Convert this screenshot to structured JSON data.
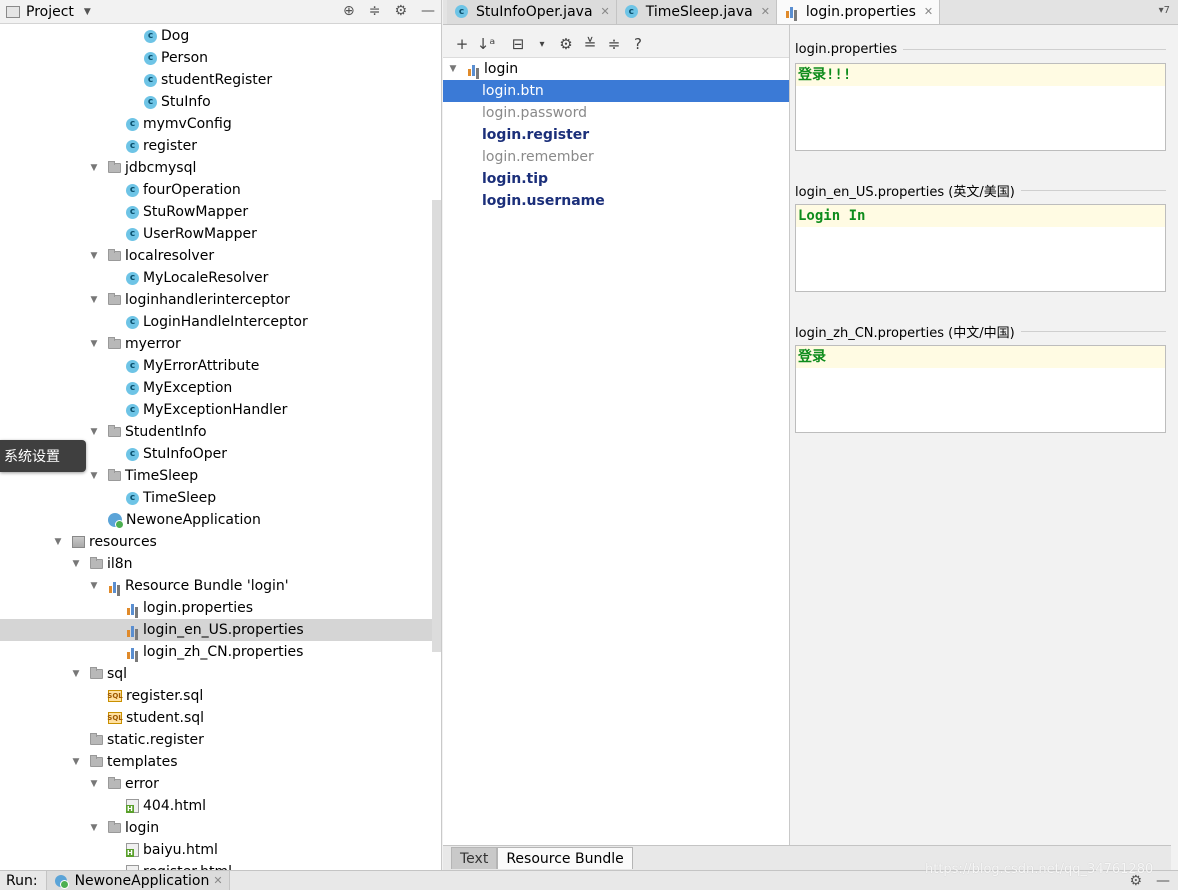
{
  "project_panel": {
    "title": "Project",
    "tools": [
      "target-icon",
      "collapse-icon",
      "gear-icon",
      "minimize-icon"
    ],
    "tree": [
      {
        "label": "Dog",
        "icon": "class-icon",
        "indent": 3,
        "caret": "none"
      },
      {
        "label": "Person",
        "icon": "class-icon",
        "indent": 3,
        "caret": "none"
      },
      {
        "label": "studentRegister",
        "icon": "class-icon",
        "indent": 3,
        "caret": "none"
      },
      {
        "label": "StuInfo",
        "icon": "class-icon",
        "indent": 3,
        "caret": "none"
      },
      {
        "label": "mymvConfig",
        "icon": "class-icon",
        "indent": 2,
        "caret": "none"
      },
      {
        "label": "register",
        "icon": "class-icon",
        "indent": 2,
        "caret": "none"
      },
      {
        "label": "jdbcmysql",
        "icon": "folder-icon",
        "indent": 1,
        "caret": "open"
      },
      {
        "label": "fourOperation",
        "icon": "class-icon",
        "indent": 2,
        "caret": "none"
      },
      {
        "label": "StuRowMapper",
        "icon": "class-icon",
        "indent": 2,
        "caret": "none"
      },
      {
        "label": "UserRowMapper",
        "icon": "class-icon",
        "indent": 2,
        "caret": "none"
      },
      {
        "label": "localresolver",
        "icon": "folder-icon",
        "indent": 1,
        "caret": "open"
      },
      {
        "label": "MyLocaleResolver",
        "icon": "class-icon",
        "indent": 2,
        "caret": "none"
      },
      {
        "label": "loginhandlerinterceptor",
        "icon": "folder-icon",
        "indent": 1,
        "caret": "open"
      },
      {
        "label": "LoginHandleInterceptor",
        "icon": "class-icon",
        "indent": 2,
        "caret": "none"
      },
      {
        "label": "myerror",
        "icon": "folder-icon",
        "indent": 1,
        "caret": "open"
      },
      {
        "label": "MyErrorAttribute",
        "icon": "class-icon",
        "indent": 2,
        "caret": "none"
      },
      {
        "label": "MyException",
        "icon": "class-icon",
        "indent": 2,
        "caret": "none"
      },
      {
        "label": "MyExceptionHandler",
        "icon": "class-icon",
        "indent": 2,
        "caret": "none"
      },
      {
        "label": "StudentInfo",
        "icon": "folder-icon",
        "indent": 1,
        "caret": "open"
      },
      {
        "label": "StuInfoOper",
        "icon": "class-icon",
        "indent": 2,
        "caret": "none"
      },
      {
        "label": "TimeSleep",
        "icon": "folder-icon",
        "indent": 1,
        "caret": "open"
      },
      {
        "label": "TimeSleep",
        "icon": "class-icon",
        "indent": 2,
        "caret": "none"
      },
      {
        "label": "NewoneApplication",
        "icon": "app-icon",
        "indent": 1,
        "caret": "none"
      },
      {
        "label": "resources",
        "icon": "resources-folder-icon",
        "indent": -1,
        "caret": "open"
      },
      {
        "label": "il8n",
        "icon": "folder-icon",
        "indent": 0,
        "caret": "open"
      },
      {
        "label": "Resource Bundle 'login'",
        "icon": "resource-bundle-icon",
        "indent": 1,
        "caret": "open"
      },
      {
        "label": "login.properties",
        "icon": "properties-icon",
        "indent": 2,
        "caret": "none"
      },
      {
        "label": "login_en_US.properties",
        "icon": "properties-icon",
        "indent": 2,
        "caret": "none",
        "selected": true
      },
      {
        "label": "login_zh_CN.properties",
        "icon": "properties-icon",
        "indent": 2,
        "caret": "none"
      },
      {
        "label": "sql",
        "icon": "folder-icon",
        "indent": 0,
        "caret": "open"
      },
      {
        "label": "register.sql",
        "icon": "sql-icon",
        "indent": 1,
        "caret": "none"
      },
      {
        "label": "student.sql",
        "icon": "sql-icon",
        "indent": 1,
        "caret": "none"
      },
      {
        "label": "static.register",
        "icon": "folder-icon",
        "indent": 0,
        "caret": "none"
      },
      {
        "label": "templates",
        "icon": "folder-icon",
        "indent": 0,
        "caret": "open"
      },
      {
        "label": "error",
        "icon": "folder-icon",
        "indent": 1,
        "caret": "open"
      },
      {
        "label": "404.html",
        "icon": "html-icon",
        "indent": 2,
        "caret": "none"
      },
      {
        "label": "login",
        "icon": "folder-icon",
        "indent": 1,
        "caret": "open"
      },
      {
        "label": "baiyu.html",
        "icon": "html-icon",
        "indent": 2,
        "caret": "none"
      },
      {
        "label": "register.html",
        "icon": "html-icon",
        "indent": 2,
        "caret": "none"
      }
    ]
  },
  "tooltip": {
    "text": "系统设置"
  },
  "editor_tabs": [
    {
      "label": "StuInfoOper.java",
      "icon": "class-icon",
      "active": false
    },
    {
      "label": "TimeSleep.java",
      "icon": "class-icon",
      "active": false
    },
    {
      "label": "login.properties",
      "icon": "properties-icon",
      "active": true
    }
  ],
  "tab_overflow": {
    "label": "7"
  },
  "rb_toolbar": [
    "add-icon",
    "sort-alpha-icon",
    "group-icon",
    "dropdown-icon",
    "gear-icon",
    "expand-all-icon",
    "collapse-all-icon",
    "help-icon"
  ],
  "key_tree": {
    "root": "login",
    "keys": [
      {
        "label": "login.btn",
        "state": "sel"
      },
      {
        "label": "login.password",
        "state": "gray"
      },
      {
        "label": "login.register",
        "state": "normal"
      },
      {
        "label": "login.remember",
        "state": "gray"
      },
      {
        "label": "login.tip",
        "state": "normal"
      },
      {
        "label": "login.username",
        "state": "normal"
      }
    ]
  },
  "value_panels": [
    {
      "title": "login.properties",
      "value": "登录!!!"
    },
    {
      "title": "login_en_US.properties (英文/美国)",
      "value": "Login In"
    },
    {
      "title": "login_zh_CN.properties (中文/中国)",
      "value": "登录"
    }
  ],
  "bottom_tabs": [
    {
      "label": "Text",
      "active": false
    },
    {
      "label": "Resource Bundle",
      "active": true
    }
  ],
  "run_bar": {
    "label": "Run:",
    "tab_label": "NewoneApplication"
  },
  "watermark": "https://blog.csdn.net/qq_34761280",
  "colors": {
    "selection": "#3b7ad6",
    "key_text": "#1b2f7a",
    "value_text": "#0e8c1c",
    "value_bg": "#fffbe3"
  }
}
